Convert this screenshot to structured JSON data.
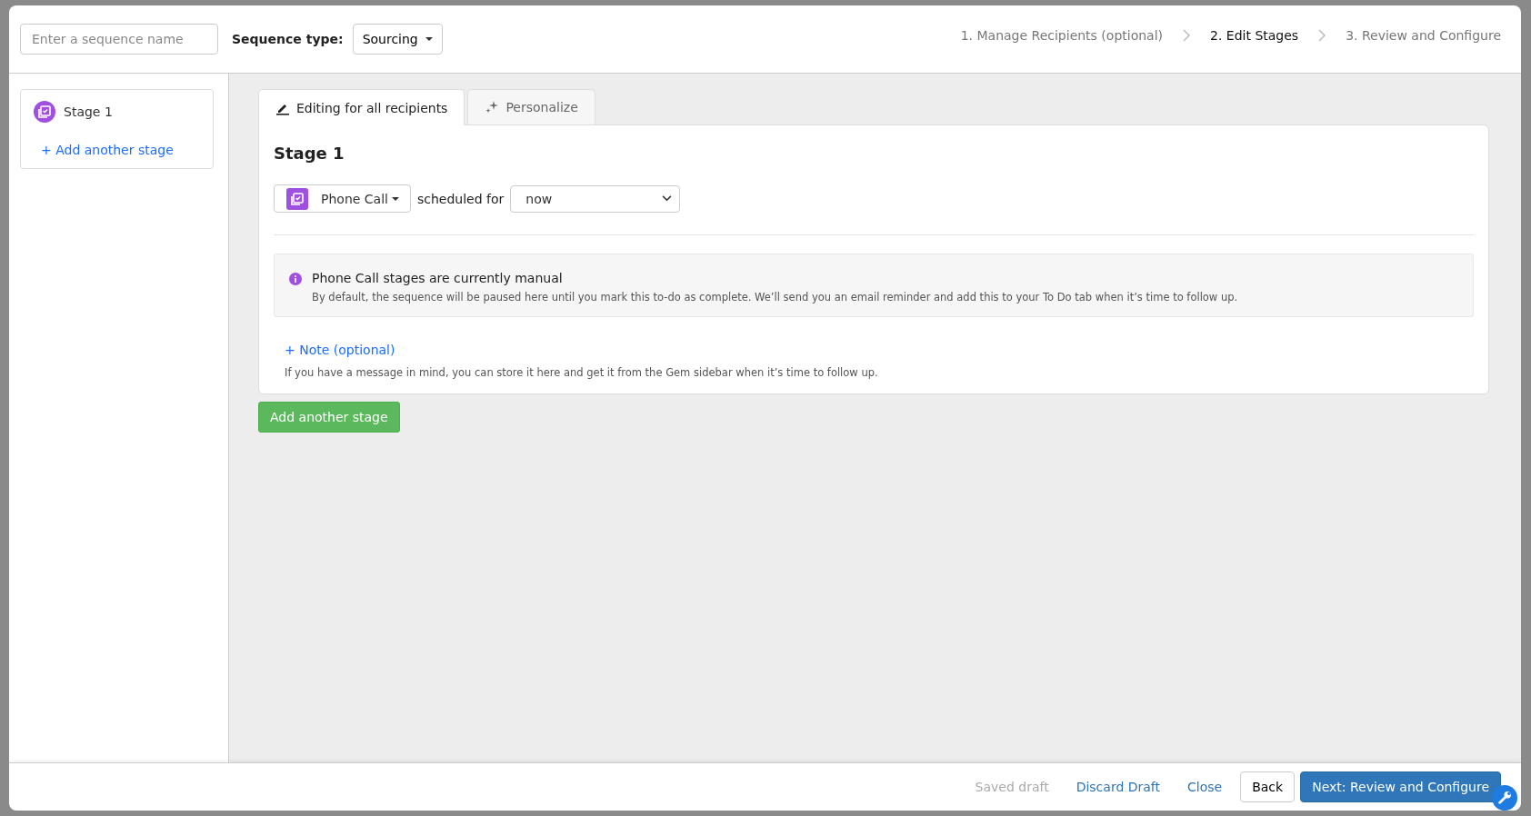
{
  "header": {
    "name_field": {
      "placeholder": "Enter a sequence name"
    },
    "sequence_type": {
      "label": "Sequence type:",
      "value": "Sourcing"
    },
    "steps": [
      {
        "label": "1. Manage Recipients (optional)",
        "selected": false
      },
      {
        "label": "2. Edit Stages",
        "selected": true
      },
      {
        "label": "3. Review and Configure",
        "selected": false
      }
    ]
  },
  "sidebar": {
    "stages": [
      {
        "label": "Stage 1",
        "selected": true
      }
    ],
    "add_link": "+ Add another stage"
  },
  "tabs": [
    {
      "label": "Editing for all recipients",
      "kind": "edit",
      "selected": true
    },
    {
      "label": "Personalize",
      "kind": "personalize",
      "selected": false
    }
  ],
  "stage": {
    "title": "Stage 1",
    "type": "Phone Call",
    "scheduled_label": "scheduled for",
    "schedule": "now",
    "info": {
      "title": "Phone Call stages are currently manual",
      "text": "By default, the sequence will be paused here until you mark this to-do as complete. We’ll send you an email reminder and add this to your To Do tab when it’s time to follow up."
    },
    "note_link": "+ Note (optional)",
    "note_help": "If you have a message in mind, you can store it here and get it from the Gem sidebar when it’s time to follow up."
  },
  "add_stage_button": "Add another stage",
  "footer": {
    "status": "Saved draft",
    "discard": "Discard Draft",
    "close": "Close",
    "back": "Back",
    "next": "Next: Review and Configure"
  }
}
